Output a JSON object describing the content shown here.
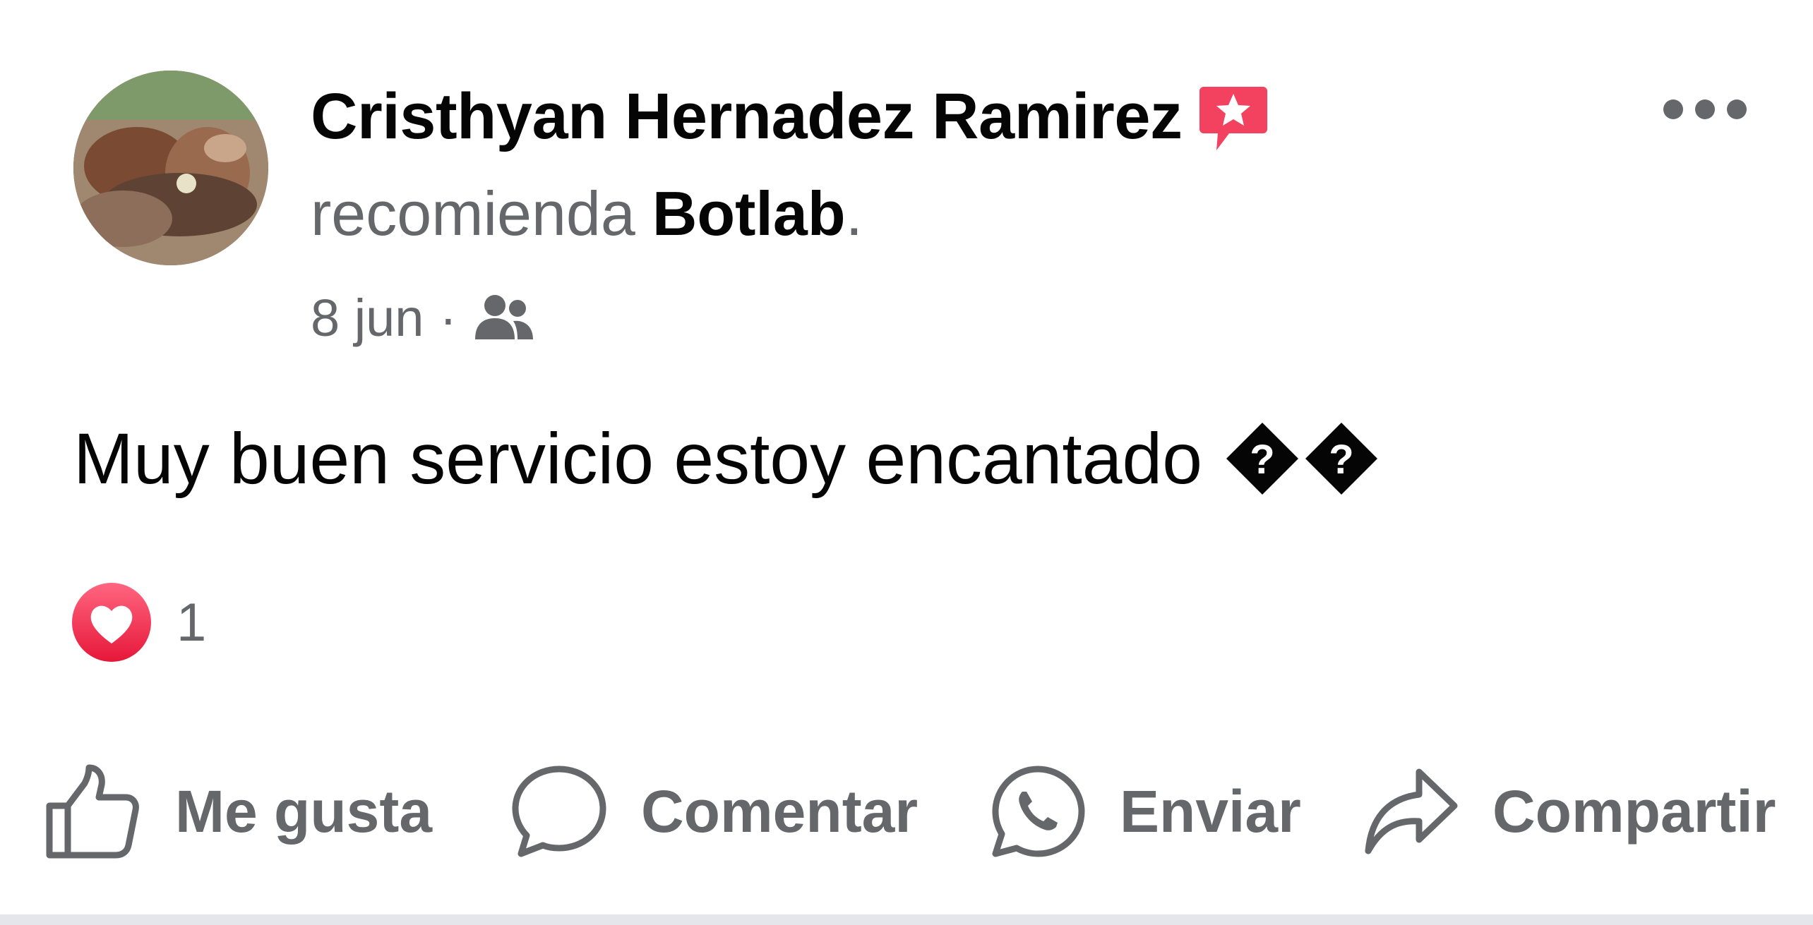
{
  "post": {
    "author": {
      "name": "Cristhyan Hernadez Ramirez",
      "badge_icon": "recommendation-star-badge-icon",
      "badge_color": "#f3425f"
    },
    "recommendation": {
      "verb": "recomienda",
      "page": "Botlab",
      "period": "."
    },
    "meta": {
      "date": "8 jun",
      "separator": "·",
      "audience_icon": "friends-icon"
    },
    "more_icon": "more-options-icon",
    "text": "Muy buen servicio estoy encantado",
    "text_trailing_glyphs": [
      "�",
      "�"
    ],
    "reactions": {
      "icon": "love-reaction-icon",
      "color": "#f0284a",
      "count": "1"
    },
    "actions": [
      {
        "icon": "like-thumb-icon",
        "label": "Me gusta"
      },
      {
        "icon": "comment-bubble-icon",
        "label": "Comentar"
      },
      {
        "icon": "whatsapp-icon",
        "label": "Enviar"
      },
      {
        "icon": "share-arrow-icon",
        "label": "Compartir"
      }
    ],
    "colors": {
      "primary_text": "#050505",
      "secondary_text": "#65676b"
    }
  }
}
